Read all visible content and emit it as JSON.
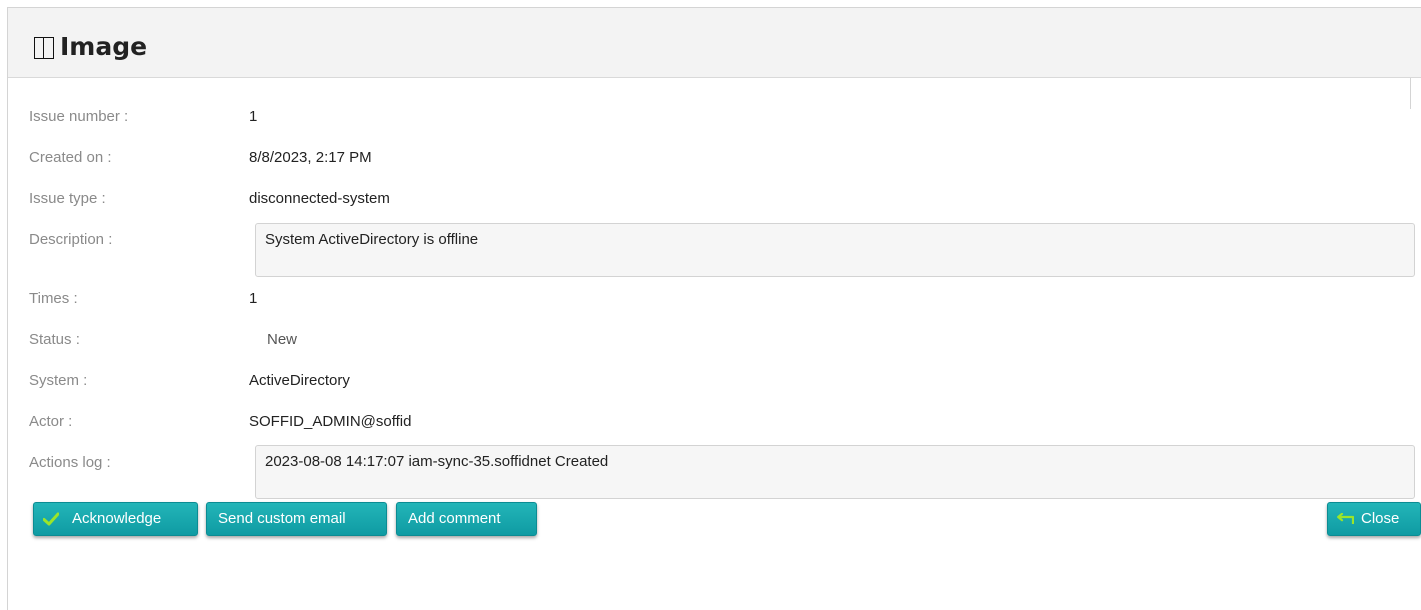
{
  "panel": {
    "title": "Image",
    "icon": "window-icon"
  },
  "fields": {
    "issue_number": {
      "label": "Issue number :",
      "value": "1"
    },
    "created_on": {
      "label": "Created on :",
      "value": "8/8/2023, 2:17 PM"
    },
    "issue_type": {
      "label": "Issue type :",
      "value": "disconnected-system"
    },
    "description": {
      "label": "Description :",
      "value": "System ActiveDirectory is offline"
    },
    "times": {
      "label": "Times :",
      "value": "1"
    },
    "status": {
      "label": "Status :",
      "value": "New"
    },
    "system": {
      "label": "System :",
      "value": "ActiveDirectory"
    },
    "actor": {
      "label": "Actor :",
      "value": "SOFFID_ADMIN@soffid"
    },
    "actions_log": {
      "label": "Actions log :",
      "value": "2023-08-08 14:17:07 iam-sync-35.soffidnet Created"
    }
  },
  "buttons": {
    "acknowledge": {
      "label": "Acknowledge",
      "icon": "checkmark-icon"
    },
    "send_custom_email": {
      "label": "Send custom email"
    },
    "add_comment": {
      "label": "Add comment"
    },
    "close": {
      "label": "Close",
      "icon": "return-arrow-icon"
    }
  },
  "colors": {
    "button_bg": "#16a8ae",
    "button_text": "#ffffff",
    "icon_accent": "#9be52a",
    "label_text": "#8a8a8a",
    "header_bg": "#f3f3f3"
  }
}
